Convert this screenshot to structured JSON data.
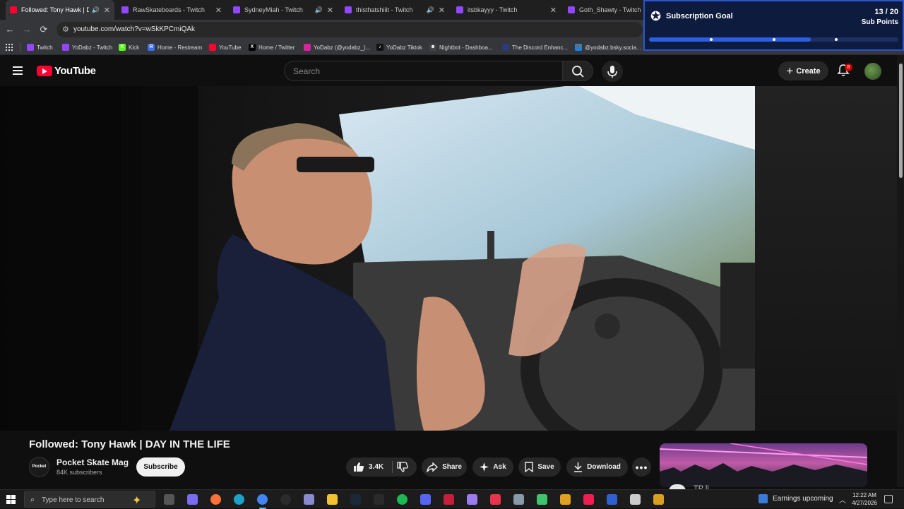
{
  "browser": {
    "tabs": [
      {
        "title": "Followed: Tony Hawk | DAY IN THE LIFE",
        "favicon_color": "#ff0033",
        "audio": true,
        "active": true
      },
      {
        "title": "RawSkateboards - Twitch",
        "favicon_color": "#9146ff",
        "audio": false,
        "active": false
      },
      {
        "title": "SydneyMiah - Twitch",
        "favicon_color": "#9146ff",
        "audio": true,
        "active": false
      },
      {
        "title": "thisthatshiiit - Twitch",
        "favicon_color": "#9146ff",
        "audio": true,
        "active": false
      },
      {
        "title": "itsbkayyy - Twitch",
        "favicon_color": "#9146ff",
        "audio": false,
        "active": false
      },
      {
        "title": "Goth_Shawty - Twitch",
        "favicon_color": "#9146ff",
        "audio": false,
        "active": false
      }
    ],
    "url": "youtube.com/watch?v=wSkKPCmiQAk",
    "bookmarks": [
      {
        "label": "Twitch",
        "icon": "twitch-icon",
        "color": "#9146ff",
        "glyph": ""
      },
      {
        "label": "YoDabz - Twitch",
        "icon": "twitch-icon",
        "color": "#9146ff",
        "glyph": ""
      },
      {
        "label": "Kick",
        "icon": "kick-icon",
        "color": "#53fc18",
        "glyph": "K"
      },
      {
        "label": "Home - Restream",
        "icon": "restream-icon",
        "color": "#3b6ef0",
        "glyph": "R"
      },
      {
        "label": "YouTube",
        "icon": "youtube-icon",
        "color": "#ff0033",
        "glyph": ""
      },
      {
        "label": "Home / Twitter",
        "icon": "x-icon",
        "color": "#000000",
        "glyph": "X"
      },
      {
        "label": "YoDabz (@yodabz_)...",
        "icon": "instagram-icon",
        "color": "#d6249f",
        "glyph": ""
      },
      {
        "label": "YoDabz Tiktok",
        "icon": "tiktok-icon",
        "color": "#111111",
        "glyph": "♪"
      },
      {
        "label": "Nightbot - Dashboa...",
        "icon": "nightbot-icon",
        "color": "#444444",
        "glyph": "☻"
      },
      {
        "label": "The Discord Enhanc...",
        "icon": "discord-icon",
        "color": "#2d3a7a",
        "glyph": ""
      },
      {
        "label": "@yodabz.bsky.socia...",
        "icon": "bluesky-icon",
        "color": "#1185fe",
        "glyph": "🦋"
      }
    ]
  },
  "sub_goal": {
    "title": "Subscription Goal",
    "count": "13 / 20",
    "unit": "Sub Points",
    "progress": 0.65,
    "markers": [
      0.25,
      0.5,
      0.75
    ],
    "accent": "#2b5fe0"
  },
  "youtube": {
    "logo_text": "YouTube",
    "search_placeholder": "Search",
    "create_label": "Create",
    "notification_count": "8",
    "video": {
      "title": "Followed: Tony Hawk | DAY IN THE LIFE",
      "channel": "Pocket Skate Mag",
      "channel_avatar_text": "Pocket",
      "subscribers": "84K subscribers",
      "subscribe_label": "Subscribe",
      "likes": "3.4K",
      "share_label": "Share",
      "ask_label": "Ask",
      "save_label": "Save",
      "download_label": "Download"
    },
    "rec_partial_title": "TP li..."
  },
  "taskbar": {
    "search_placeholder": "Type here to search",
    "earnings_label": "Earnings upcoming",
    "time": "12:22 AM",
    "date": "4/27/2026",
    "apps": [
      {
        "name": "task-view-icon",
        "color": "#555555"
      },
      {
        "name": "copilot-icon",
        "color": "#7a6cf0"
      },
      {
        "name": "firefox-icon",
        "color": "#ff7139"
      },
      {
        "name": "edge-icon",
        "color": "#1da1c9"
      },
      {
        "name": "chrome-icon",
        "color": "#4285f4"
      },
      {
        "name": "obs-icon",
        "color": "#2b2b2b"
      },
      {
        "name": "app-icon",
        "color": "#8a8ad0"
      },
      {
        "name": "file-explorer-icon",
        "color": "#f2c230"
      },
      {
        "name": "steam-icon",
        "color": "#1b2838"
      },
      {
        "name": "epic-games-icon",
        "color": "#2a2a2a"
      },
      {
        "name": "spotify-icon",
        "color": "#1db954"
      },
      {
        "name": "discord-icon",
        "color": "#5865f2"
      },
      {
        "name": "app-icon",
        "color": "#c41e3a"
      },
      {
        "name": "feather-icon",
        "color": "#9a7cf0"
      },
      {
        "name": "app-icon",
        "color": "#e8344a"
      },
      {
        "name": "app-icon",
        "color": "#8899aa"
      },
      {
        "name": "app-icon",
        "color": "#3ec46d"
      },
      {
        "name": "app-icon",
        "color": "#e0a020"
      },
      {
        "name": "tiktok-icon",
        "color": "#ee1d52"
      },
      {
        "name": "app-icon",
        "color": "#3060d0"
      },
      {
        "name": "settings-icon",
        "color": "#cccccc"
      },
      {
        "name": "app-icon",
        "color": "#d8a020"
      }
    ]
  }
}
